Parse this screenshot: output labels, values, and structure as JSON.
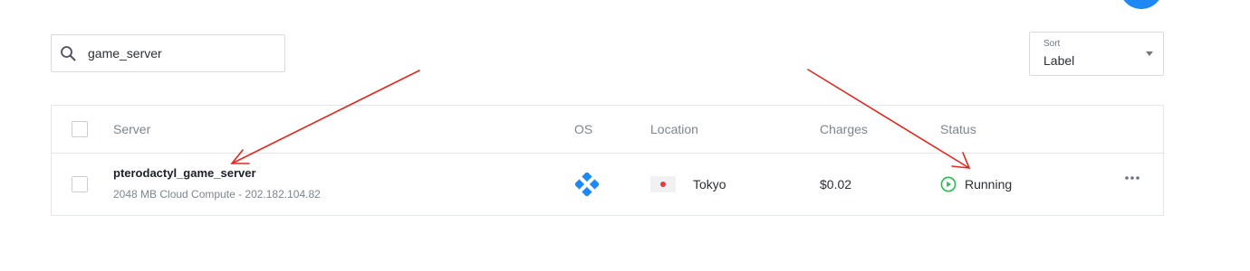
{
  "colors": {
    "accent": "#1e88f5",
    "status_running": "#2fbf56",
    "arrow": "#e3261d",
    "os_icon": "#1e88f5",
    "flag_dot": "#e53946"
  },
  "search": {
    "value": "game_server",
    "icon": "search-icon"
  },
  "sort": {
    "caption": "Sort",
    "value": "Label"
  },
  "table": {
    "columns": [
      "Server",
      "OS",
      "Location",
      "Charges",
      "Status"
    ],
    "rows": [
      {
        "name": "pterodactyl_game_server",
        "subtitle": "2048 MB Cloud Compute - 202.182.104.82",
        "os_icon": "os-logo-icon",
        "location_flag": "japan-flag-icon",
        "location": "Tokyo",
        "charges": "$0.02",
        "status": "Running",
        "status_icon": "play-circle-icon",
        "actions_icon": "more-icon"
      }
    ]
  }
}
